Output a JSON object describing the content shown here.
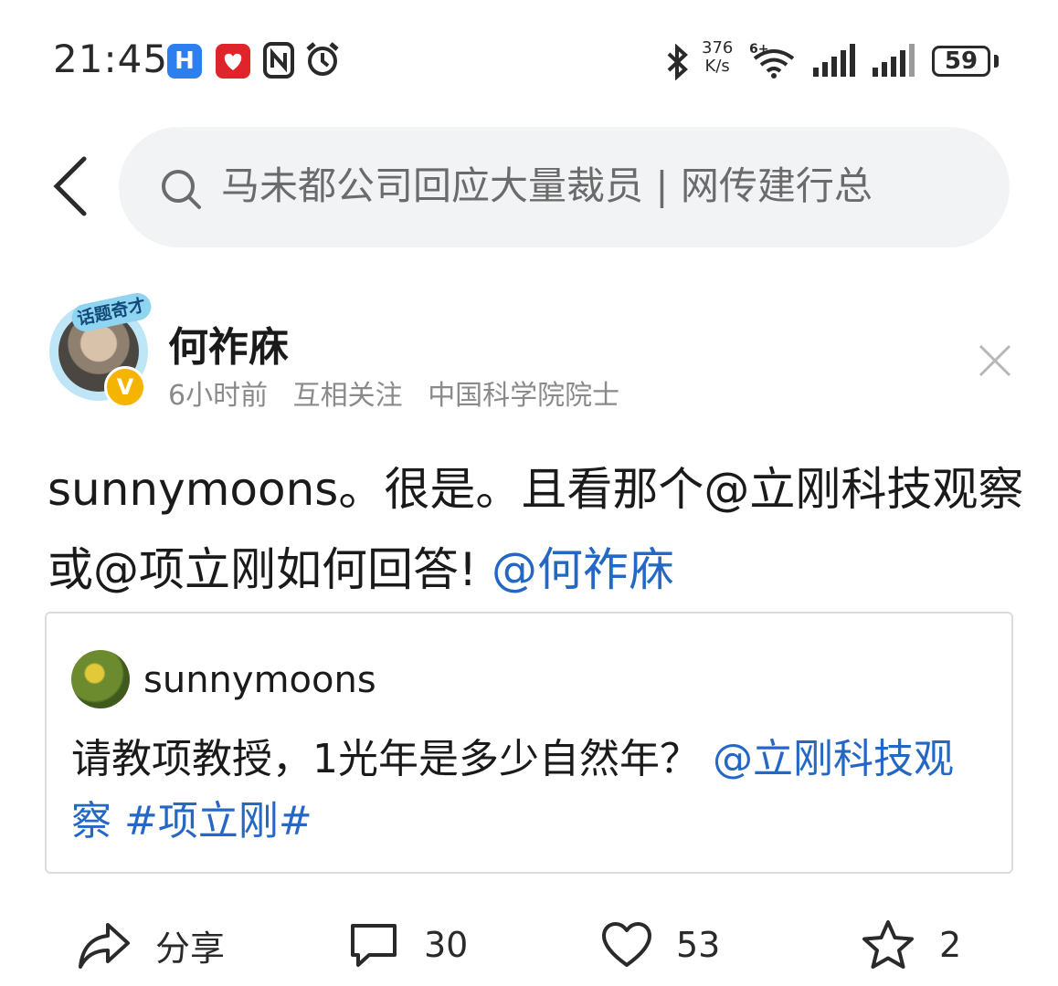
{
  "status_bar": {
    "time": "21:45",
    "net_speed_value": "376",
    "net_speed_unit": "K/s",
    "battery": "59",
    "icons": [
      "harmony-app-icon",
      "pinduoduo-icon",
      "nfc-icon",
      "alarm-icon",
      "bluetooth-icon",
      "wifi-6-icon",
      "signal-icon",
      "signal-icon"
    ]
  },
  "header": {
    "search_text": "马未都公司回应大量裁员 | 网传建行总"
  },
  "post": {
    "author": "何祚庥",
    "avatar_badge": "话题奇才",
    "verified_mark": "V",
    "time_ago": "6小时前",
    "relation": "互相关注",
    "title": "中国科学院院士",
    "text_plain": "sunnymoons。很是。且看那个@立刚科技观察或@项立刚如何回答!",
    "text_mention": "@何祚庥"
  },
  "quote": {
    "author": "sunnymoons",
    "text_plain": "请教项教授，1光年是多少自然年？",
    "text_links": "@立刚科技观察 #项立刚#"
  },
  "actions": {
    "share_label": "分享",
    "comments": "30",
    "likes": "53",
    "favorites": "2"
  },
  "colors": {
    "link": "#2468c4",
    "search_bg": "#f2f3f5",
    "meta_text": "#8a8a8a"
  }
}
